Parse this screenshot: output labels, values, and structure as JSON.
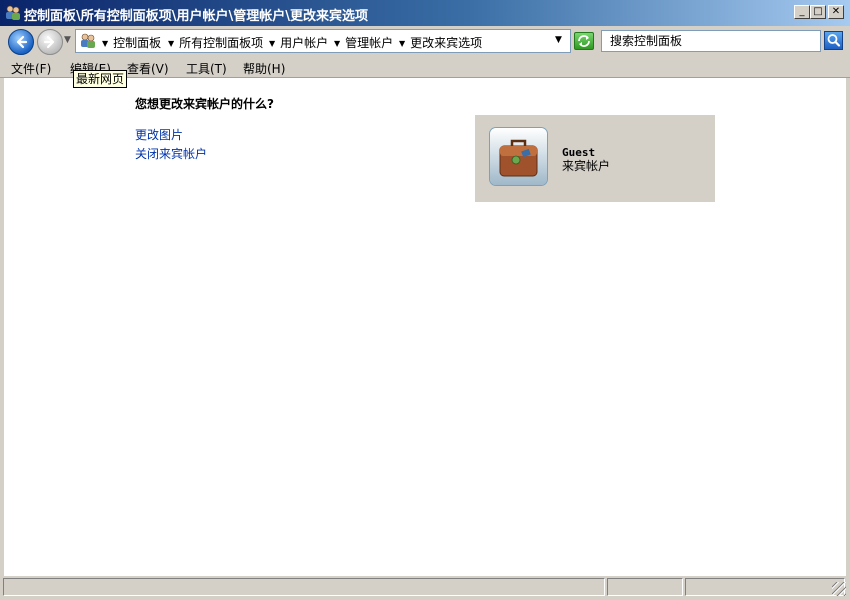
{
  "window": {
    "title": "控制面板\\所有控制面板项\\用户帐户\\管理帐户\\更改来宾选项",
    "min_label": "_",
    "max_label": "□",
    "close_label": "✕"
  },
  "address": {
    "breadcrumbs": [
      "控制面板",
      "所有控制面板项",
      "用户帐户",
      "管理帐户",
      "更改来宾选项"
    ],
    "search_placeholder": "搜索控制面板"
  },
  "menu": [
    {
      "label": "文件(F)"
    },
    {
      "label": "编辑(E)"
    },
    {
      "label": "查看(V)"
    },
    {
      "label": "工具(T)"
    },
    {
      "label": "帮助(H)"
    }
  ],
  "tooltip": "最新网页",
  "content": {
    "question": "您想更改来宾帐户的什么?",
    "tasks": [
      "更改图片",
      "关闭来宾帐户"
    ],
    "account": {
      "name": "Guest",
      "type": "来宾帐户"
    }
  },
  "colors": {
    "link": "#0033aa",
    "title_gradient_start": "#0a246a"
  },
  "icons": [
    "users-icon",
    "back-arrow-icon",
    "forward-arrow-icon",
    "refresh-icon",
    "search-icon",
    "briefcase-icon",
    "size-grip-icon"
  ]
}
